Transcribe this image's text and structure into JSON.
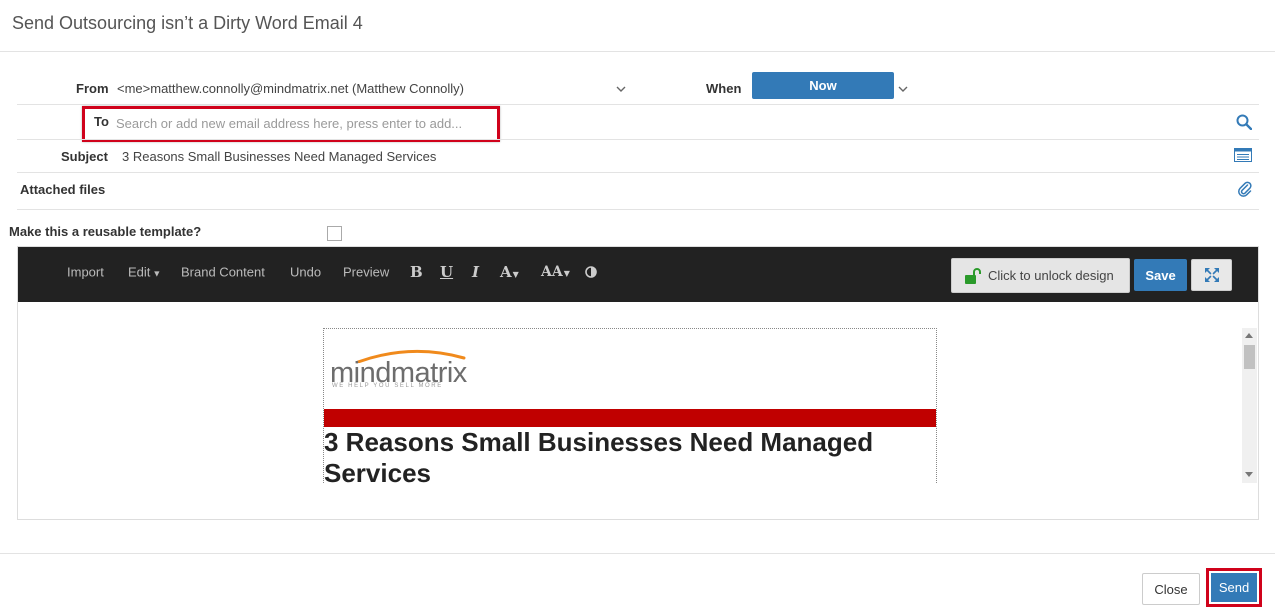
{
  "window": {
    "title": "Send Outsourcing isn’t a Dirty Word Email 4"
  },
  "form": {
    "from_label": "From",
    "from_value": "<me>matthew.connolly@mindmatrix.net (Matthew Connolly)",
    "when_label": "When",
    "when_value": "Now",
    "to_label": "To",
    "to_placeholder": "Search or add new email address here, press enter to add...",
    "subject_label": "Subject",
    "subject_value": "3 Reasons Small Businesses Need Managed Services",
    "attached_label": "Attached files",
    "template_label": "Make this a reusable template?"
  },
  "toolbar": {
    "import": "Import",
    "edit": "Edit",
    "brand_content": "Brand Content",
    "undo": "Undo",
    "preview": "Preview",
    "bold": "B",
    "underline": "U",
    "italic": "I",
    "font_color": "A",
    "font_size": "AA",
    "unlock": "Click to unlock design",
    "save": "Save"
  },
  "email_preview": {
    "logo_word": "mindmatrix",
    "logo_tagline": "WE HELP YOU SELL MORE",
    "headline": "3 Reasons Small Businesses Need Managed Services"
  },
  "footer": {
    "close": "Close",
    "send": "Send"
  },
  "colors": {
    "primary": "#337ab7",
    "highlight": "#d0021b",
    "toolbar": "#222222",
    "banner": "#c00000",
    "lock": "#2a9a2a",
    "logo_arc": "#f08a1c"
  }
}
